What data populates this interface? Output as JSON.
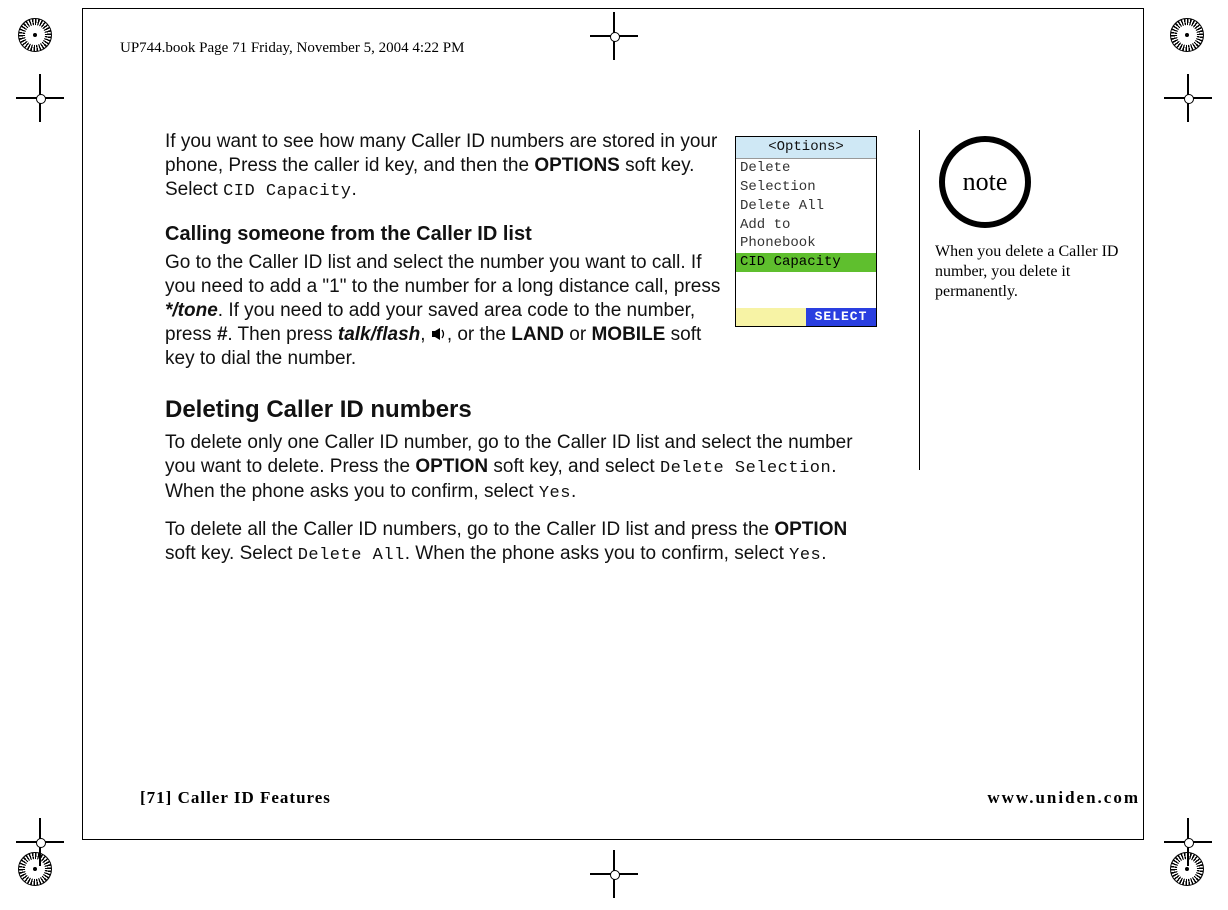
{
  "header": {
    "running": "UP744.book  Page 71  Friday, November 5, 2004  4:22 PM"
  },
  "intro": {
    "t1": "If you want to see how many Caller ID numbers are stored in your phone, Press the caller id key, and then the ",
    "options": "OPTIONS",
    "t2": " soft key. Select ",
    "cid": "CID Capacity",
    "t3": "."
  },
  "calling": {
    "head": "Calling someone from the Caller ID list",
    "t1": "Go to the Caller ID list and select the number you want to call. If you need to add a \"1\" to the number for a long distance call, press ",
    "star": " */tone",
    "t2": ". If you need to add your saved area code to the number, press ",
    "hash": "#",
    "t3": ". Then press ",
    "talk": "talk/flash",
    "t4": ", ",
    "t5": ", or the ",
    "land": "LAND",
    "t6": " or ",
    "mobile": "MOBILE",
    "t7": " soft key to dial the number."
  },
  "deleting": {
    "head": "Deleting Caller ID numbers",
    "p1a": "To delete only one Caller ID number, go to the Caller ID list and select the number you want to delete. Press the ",
    "option1": "OPTION",
    "p1b": " soft key, and select ",
    "delsel": "Delete Selection",
    "p1c": ". When the phone asks you to confirm, select ",
    "yes1": "Yes",
    "p1d": ".",
    "p2a": "To delete all the Caller ID numbers, go to the Caller ID list and press the ",
    "option2": "OPTION",
    "p2b": " soft key. Select ",
    "delall": "Delete All",
    "p2c": ". When the phone asks you to confirm, select ",
    "yes2": "Yes",
    "p2d": "."
  },
  "phone": {
    "title": "<Options>",
    "items": [
      "Delete Selection",
      "Delete All",
      "Add to Phonebook",
      "CID Capacity"
    ],
    "selected_index": 3,
    "softkey_right": "SELECT"
  },
  "note": {
    "label": "note",
    "text": "When you delete a Caller ID number, you delete it permanently."
  },
  "footer": {
    "left": "[71] Caller ID Features",
    "right": "www.uniden.com"
  }
}
